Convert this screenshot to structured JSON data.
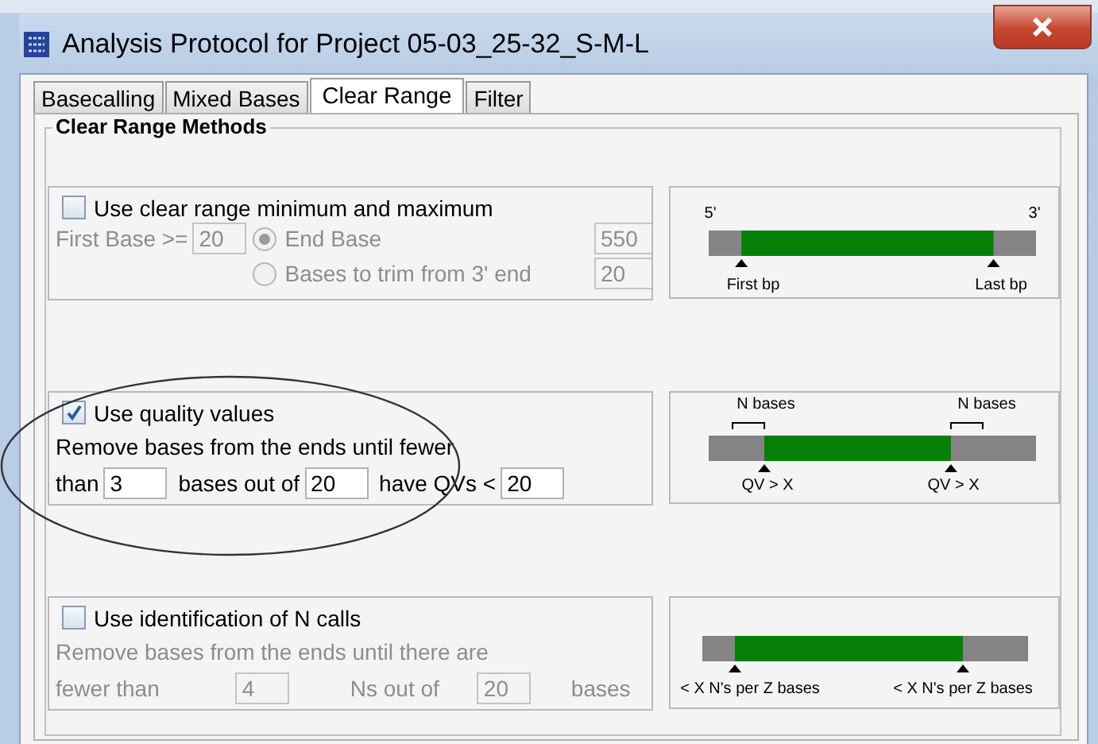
{
  "window": {
    "title": "Analysis Protocol for Project 05-03_25-32_S-M-L"
  },
  "tabs": [
    {
      "label": "Basecalling",
      "selected": false
    },
    {
      "label": "Mixed Bases",
      "selected": false
    },
    {
      "label": "Clear Range",
      "selected": true
    },
    {
      "label": "Filter",
      "selected": false
    }
  ],
  "group_title": "Clear Range Methods",
  "methods": [
    {
      "kind": "minmax",
      "label": "Use clear range minimum and maximum",
      "checked": false,
      "disabled": true,
      "first_label": "First Base >=",
      "first_value": "20",
      "options": [
        {
          "label": "End Base",
          "selected": true,
          "value": "550"
        },
        {
          "label": "Bases to trim from 3' end",
          "selected": false,
          "value": "20"
        }
      ],
      "diagram": {
        "kind": "first_last",
        "labels": [
          "5'",
          "3'",
          "First bp",
          "Last bp"
        ]
      }
    },
    {
      "kind": "lines",
      "label": "Use quality values",
      "checked": true,
      "disabled": false,
      "lines": [
        [
          {
            "kind": "text",
            "text": "Remove bases from the ends until fewer"
          }
        ],
        [
          {
            "kind": "text",
            "text": "than"
          },
          {
            "kind": "field",
            "value": "3"
          },
          {
            "kind": "text",
            "text": "bases out of"
          },
          {
            "kind": "field",
            "value": "20"
          },
          {
            "kind": "text",
            "text": "have QVs <"
          },
          {
            "kind": "field",
            "value": "20"
          }
        ]
      ],
      "diagram": {
        "kind": "qv",
        "labels": [
          "N bases",
          "N bases",
          "QV > X",
          "QV > X"
        ]
      }
    },
    {
      "kind": "lines",
      "label": "Use identification of N calls",
      "checked": false,
      "disabled": true,
      "lines": [
        [
          {
            "kind": "text",
            "text": "Remove bases from the ends until there are"
          }
        ],
        [
          {
            "kind": "text",
            "text": "fewer than"
          },
          {
            "kind": "field",
            "value": "4"
          },
          {
            "kind": "text",
            "text": "Ns out of"
          },
          {
            "kind": "field",
            "value": "20"
          },
          {
            "kind": "text",
            "text": "bases"
          }
        ]
      ],
      "diagram": {
        "kind": "ncalls",
        "labels": [
          "< X N's per Z bases",
          "< X N's per Z bases"
        ]
      }
    }
  ]
}
